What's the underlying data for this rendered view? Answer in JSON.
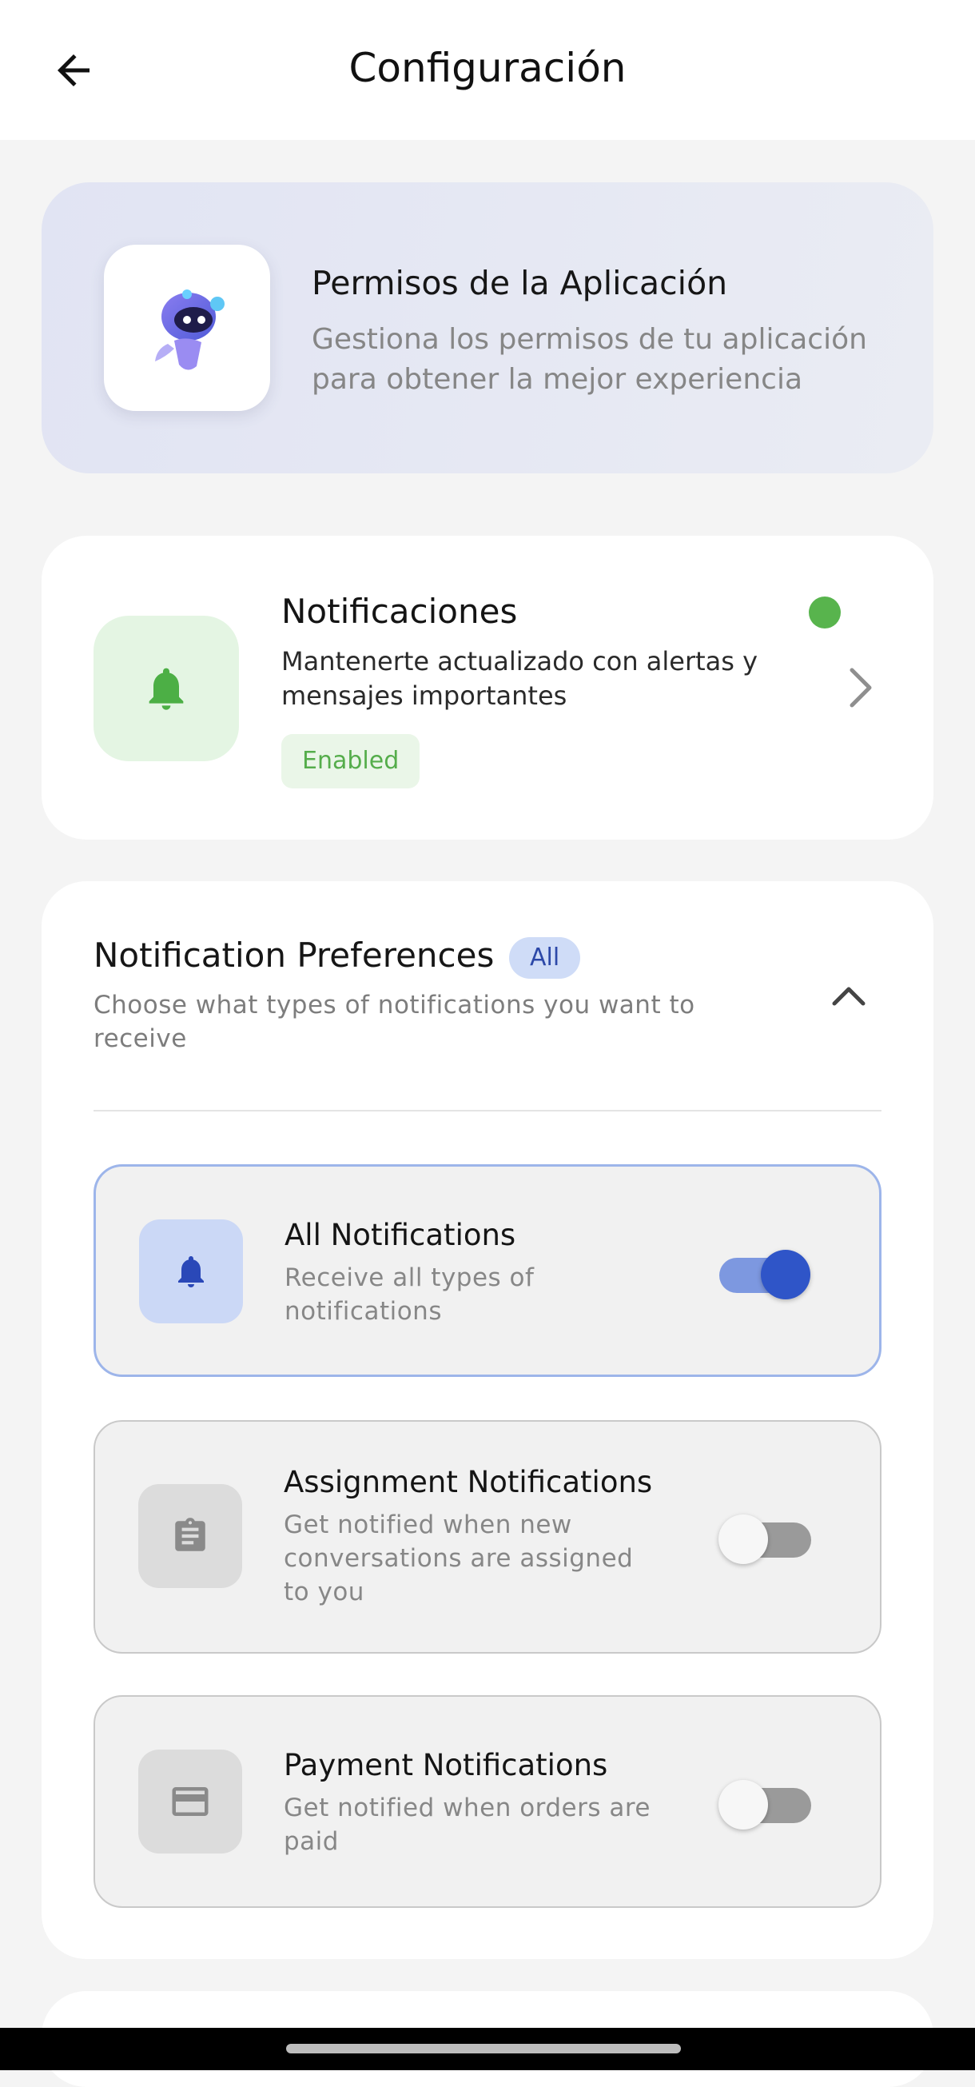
{
  "header": {
    "title": "Configuración",
    "back_icon": "arrow-left-icon"
  },
  "hero": {
    "logo_icon": "robot-mascot-icon",
    "title": "Permisos de la Aplicación",
    "description": "Gestiona los permisos de tu aplicación para obtener la mejor experiencia"
  },
  "notifications_permission": {
    "icon": "bell-icon",
    "title": "Notificaciones",
    "description": "Mantenerte actualizado con alertas y mensajes importantes",
    "status_badge": "Enabled",
    "status_color": "#58b44d",
    "chevron_icon": "chevron-right-icon"
  },
  "preferences": {
    "title": "Notification Preferences",
    "badge": "All",
    "description": "Choose what types of notifications you want to receive",
    "collapse_icon": "chevron-up-icon",
    "options": [
      {
        "icon": "bell-icon",
        "title": "All Notifications",
        "description": "Receive all types of notifications",
        "enabled": true
      },
      {
        "icon": "clipboard-icon",
        "title": "Assignment Notifications",
        "description": "Get notified when new conversations are assigned to you",
        "enabled": false
      },
      {
        "icon": "credit-card-icon",
        "title": "Payment Notifications",
        "description": "Get notified when orders are paid",
        "enabled": false
      }
    ]
  },
  "colors": {
    "accent_blue": "#2f55c8",
    "accent_green": "#58b44d"
  }
}
